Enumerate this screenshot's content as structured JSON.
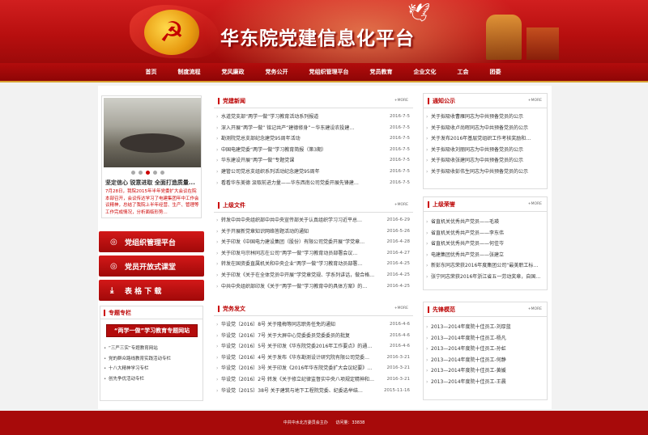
{
  "header": {
    "title": "华东院党建信息化平台",
    "emblem": "☭"
  },
  "nav": [
    "首页",
    "制度流程",
    "党风廉政",
    "党务公开",
    "党组织管理平台",
    "党员教育",
    "企业文化",
    "工会",
    "团委"
  ],
  "slider": {
    "caption": "坚定信心 锐意进取 全面打造质量...",
    "text": "7月28日，我院2015年半年党委扩大会议在院本部召开，会议传达学习了电建集团年中工作会议精神，总结了我院上半年经营、生产、管理等工作完成情况，分析面临形势..."
  },
  "left_buttons": [
    {
      "icon": "◎",
      "label": "党组织管理平台"
    },
    {
      "icon": "◎",
      "label": "党员开放式课堂"
    },
    {
      "icon": "⤓",
      "label": "表 格 下 载"
    }
  ],
  "special": {
    "title": "专题专栏",
    "banner": "“两学一做”学习教育专题网站",
    "items": [
      "“三严三实”专题教育网站",
      "党的群众路线教育实践活动专栏",
      "十八大精神学习专栏",
      "创先争优活动专栏"
    ]
  },
  "news": {
    "title": "党建新闻",
    "more": "+MORE",
    "items": [
      {
        "t": "水道党支部“两学一做”学习教育活动系列报道",
        "d": "2016-7-5"
      },
      {
        "t": "深入开展“两学一做” 铭记共产“建德修身”－华东建设农投建…",
        "d": "2016-7-5"
      },
      {
        "t": "勘测院党总支部纪念建党95周年活动",
        "d": "2016-7-5"
      },
      {
        "t": "中国电建党委“两学一做”学习教育简报（第3期）",
        "d": "2016-7-5"
      },
      {
        "t": "华东建设开展“两学一做”专题党课",
        "d": "2016-7-5"
      },
      {
        "t": "建管公司党总支组织系列活动纪念建党95周年",
        "d": "2016-7-5"
      },
      {
        "t": "看看华东美德 汲取前进力量——华东西南公司党委开展先锋建…",
        "d": "2016-7-5"
      }
    ]
  },
  "docs": {
    "title": "上级文件",
    "more": "+MORE",
    "items": [
      {
        "t": "转发中共中央组织部中共中央宣传部关于认真组织学习习近平总…",
        "d": "2016-6-29"
      },
      {
        "t": "关于开展新党章知识网络答题活动的通知",
        "d": "2016-5-26"
      },
      {
        "t": "关于印发《中国电力建设集团（股份）有限公司党委开展“学党章…",
        "d": "2016-4-28"
      },
      {
        "t": "关于印发马宗林同志在公司“两学一做”学习教育动员部署会议…",
        "d": "2016-4-27"
      },
      {
        "t": "转发在国资委直属机关和中央企业“两学一做”学习教育动员部署…",
        "d": "2016-4-25"
      },
      {
        "t": "关于印发《关于在全体党员中开展“学党章党规、学系列讲话，做合格…",
        "d": "2016-4-25"
      },
      {
        "t": "中共中央组织部印发《关于“两学一做”学习教育中的具体方案》的…",
        "d": "2016-4-25"
      }
    ]
  },
  "pub": {
    "title": "党务发文",
    "more": "+MORE",
    "items": [
      {
        "t": "华设党〔2016〕8号 关于隆梅等同志职务任免的通知",
        "d": "2016-4-6"
      },
      {
        "t": "华设党〔2016〕7号 关于大屏中心党委委员党委委员的批复",
        "d": "2016-4-6"
      },
      {
        "t": "华设党〔2016〕5号 关于印发《华东院党委2016年工作要点》的通…",
        "d": "2016-4-6"
      },
      {
        "t": "华设党〔2016〕4号 关于发布《华东勘测设计研究院有限公司党委…",
        "d": "2016-3-21"
      },
      {
        "t": "华设党〔2016〕3号 关于印发《2016年华东院党委扩大会议纪要》…",
        "d": "2016-3-21"
      },
      {
        "t": "华设党〔2016〕2号 转发《关于修立纪律监督实中央八项规定精神和…",
        "d": "2016-3-21"
      },
      {
        "t": "华设党〔2015〕38号 关于建筑与地下工程院党委、纪委选举结…",
        "d": "2015-11-16"
      }
    ]
  },
  "notice": {
    "title": "通知公示",
    "more": "+MORE",
    "items": [
      "关于拟吸收曹雁同志为中共预备党员的公示",
      "关于拟吸收卢尚晖同志为中共预备党员的公示",
      "关于发布2016年基层党组织工作考核奖励和…",
      "关于拟吸收刘丽同志为中共预备党员的公示",
      "关于拟吸收张建同志为中共预备党员的公示",
      "关于拟吸收彭伟生同志为中共预备党员的公示"
    ]
  },
  "honor": {
    "title": "上级荣誉",
    "more": "+MORE",
    "items": [
      "省直机关优秀共产党员——毛瑛",
      "省直机关优秀共产党员——李东伟",
      "省直机关优秀共产党员——何佳岑",
      "电建集团优秀共产党员——张建立",
      "新彭东同志荣获2016年度集团公司“最美职工标…",
      "张宁同志荣获2016年浙江省五一劳动奖章，自国…"
    ]
  },
  "model": {
    "title": "先锋模范",
    "more": "+MORE",
    "items": [
      "2013—2014年度院十佳员工-刘厚蓝",
      "2013—2014年度院十佳员工-杨凡",
      "2013—2014年度院十佳员工-孙虹",
      "2013—2014年度院十佳员工-何静",
      "2013—2014年度院十佳员工-黄媛",
      "2013—2014年度院十佳员工-王晨"
    ]
  },
  "footer": {
    "org": "中共中水北方委员会主办",
    "visits": "访问量：33838"
  }
}
